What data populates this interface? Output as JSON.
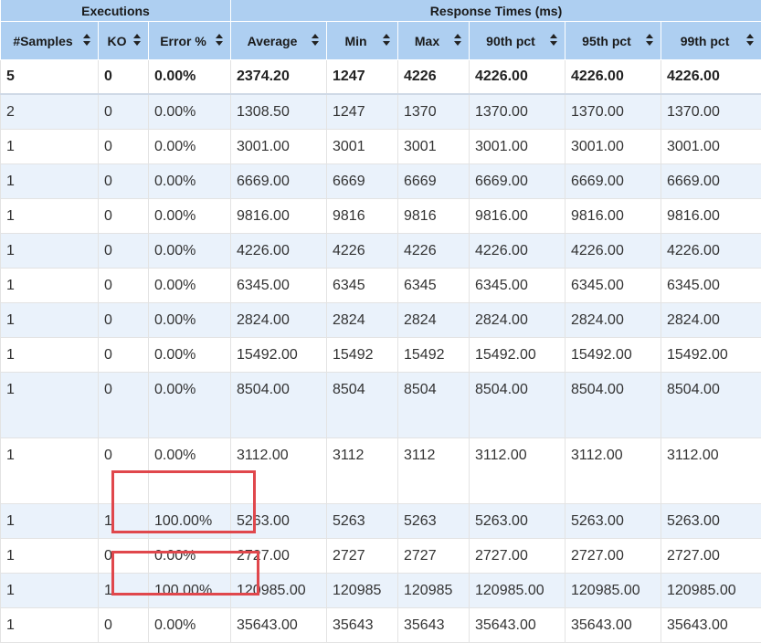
{
  "group_headers": {
    "executions": "Executions",
    "response_times": "Response Times (ms)"
  },
  "columns": [
    "#Samples",
    "KO",
    "Error %",
    "Average",
    "Min",
    "Max",
    "90th pct",
    "95th pct",
    "99th pct"
  ],
  "total": [
    "5",
    "0",
    "0.00%",
    "2374.20",
    "1247",
    "4226",
    "4226.00",
    "4226.00",
    "4226.00"
  ],
  "rows": [
    [
      "2",
      "0",
      "0.00%",
      "1308.50",
      "1247",
      "1370",
      "1370.00",
      "1370.00",
      "1370.00"
    ],
    [
      "1",
      "0",
      "0.00%",
      "3001.00",
      "3001",
      "3001",
      "3001.00",
      "3001.00",
      "3001.00"
    ],
    [
      "1",
      "0",
      "0.00%",
      "6669.00",
      "6669",
      "6669",
      "6669.00",
      "6669.00",
      "6669.00"
    ],
    [
      "1",
      "0",
      "0.00%",
      "9816.00",
      "9816",
      "9816",
      "9816.00",
      "9816.00",
      "9816.00"
    ],
    [
      "1",
      "0",
      "0.00%",
      "4226.00",
      "4226",
      "4226",
      "4226.00",
      "4226.00",
      "4226.00"
    ],
    [
      "1",
      "0",
      "0.00%",
      "6345.00",
      "6345",
      "6345",
      "6345.00",
      "6345.00",
      "6345.00"
    ],
    [
      "1",
      "0",
      "0.00%",
      "2824.00",
      "2824",
      "2824",
      "2824.00",
      "2824.00",
      "2824.00"
    ],
    [
      "1",
      "0",
      "0.00%",
      "15492.00",
      "15492",
      "15492",
      "15492.00",
      "15492.00",
      "15492.00"
    ],
    [
      "1",
      "0",
      "0.00%",
      "8504.00",
      "8504",
      "8504",
      "8504.00",
      "8504.00",
      "8504.00"
    ],
    [
      "1",
      "0",
      "0.00%",
      "3112.00",
      "3112",
      "3112",
      "3112.00",
      "3112.00",
      "3112.00"
    ],
    [
      "1",
      "1",
      "100.00%",
      "5263.00",
      "5263",
      "5263",
      "5263.00",
      "5263.00",
      "5263.00"
    ],
    [
      "1",
      "0",
      "0.00%",
      "2727.00",
      "2727",
      "2727",
      "2727.00",
      "2727.00",
      "2727.00"
    ],
    [
      "1",
      "1",
      "100.00%",
      "120985.00",
      "120985",
      "120985",
      "120985.00",
      "120985.00",
      "120985.00"
    ],
    [
      "1",
      "0",
      "0.00%",
      "35643.00",
      "35643",
      "35643",
      "35643.00",
      "35643.00",
      "35643.00"
    ]
  ],
  "colors": {
    "header_bg": "#aecff1",
    "stripe_bg": "#eaf2fb",
    "highlight": "#e0474c"
  }
}
